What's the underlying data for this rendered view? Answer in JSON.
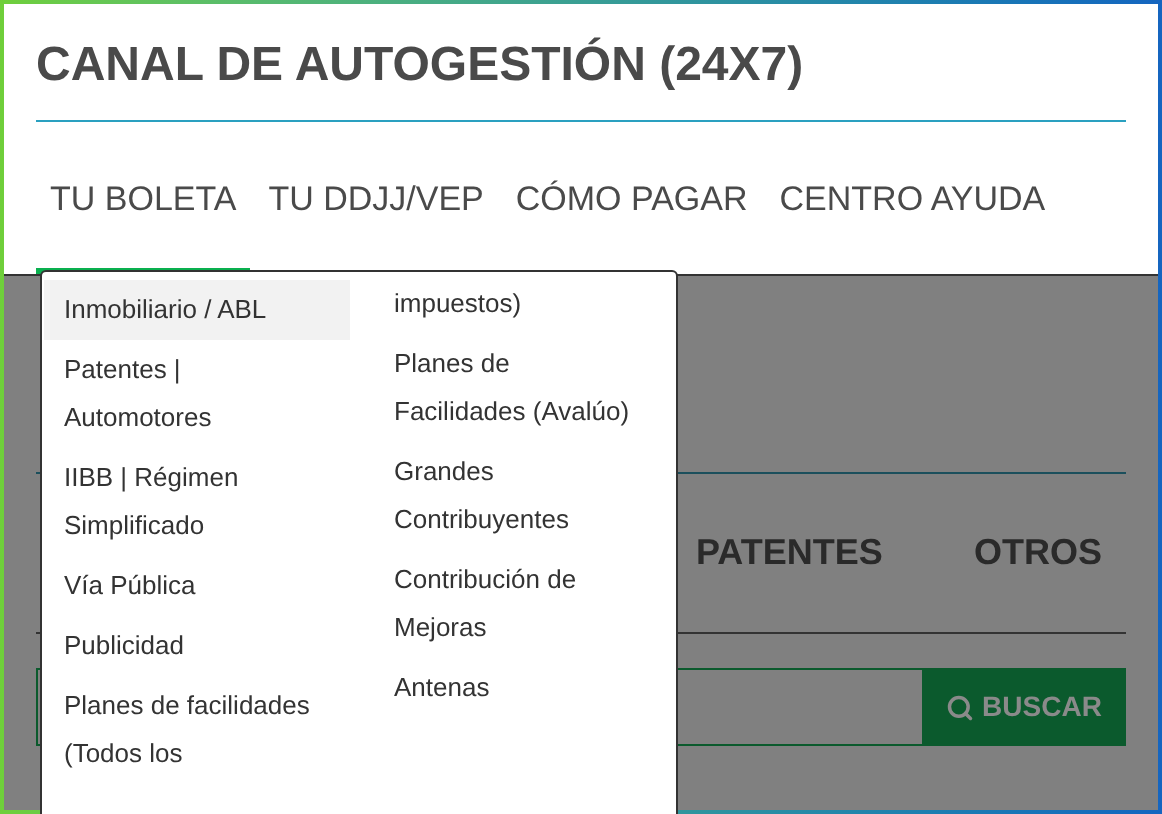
{
  "title": "CANAL DE AUTOGESTIÓN (24X7)",
  "tabs": [
    {
      "label": "TU BOLETA",
      "selected": true
    },
    {
      "label": "TU DDJJ/VEP",
      "selected": false
    },
    {
      "label": "CÓMO PAGAR",
      "selected": false
    },
    {
      "label": "CENTRO AYUDA",
      "selected": false
    }
  ],
  "background": {
    "subtabs": [
      "PATENTES",
      "OTROS"
    ],
    "search_button": "BUSCAR"
  },
  "dropdown": {
    "columns": [
      [
        {
          "lines": [
            "Inmobiliario / ABL"
          ],
          "selected": true
        },
        {
          "lines": [
            "Patentes |",
            "Automotores"
          ],
          "selected": false
        },
        {
          "lines": [
            "IIBB | Régimen",
            "Simplificado"
          ],
          "selected": false
        },
        {
          "lines": [
            "Vía Pública"
          ],
          "selected": false
        },
        {
          "lines": [
            "Publicidad"
          ],
          "selected": false
        },
        {
          "lines": [
            "Planes de facilidades",
            "(Todos los"
          ],
          "selected": false
        }
      ],
      [
        {
          "lines": [
            "impuestos)"
          ],
          "selected": false
        },
        {
          "lines": [
            "Planes de",
            "Facilidades (Avalúo)"
          ],
          "selected": false
        },
        {
          "lines": [
            "Grandes",
            "Contribuyentes"
          ],
          "selected": false
        },
        {
          "lines": [
            "Contribución de",
            "Mejoras"
          ],
          "selected": false
        },
        {
          "lines": [
            "Antenas"
          ],
          "selected": false
        }
      ]
    ]
  }
}
